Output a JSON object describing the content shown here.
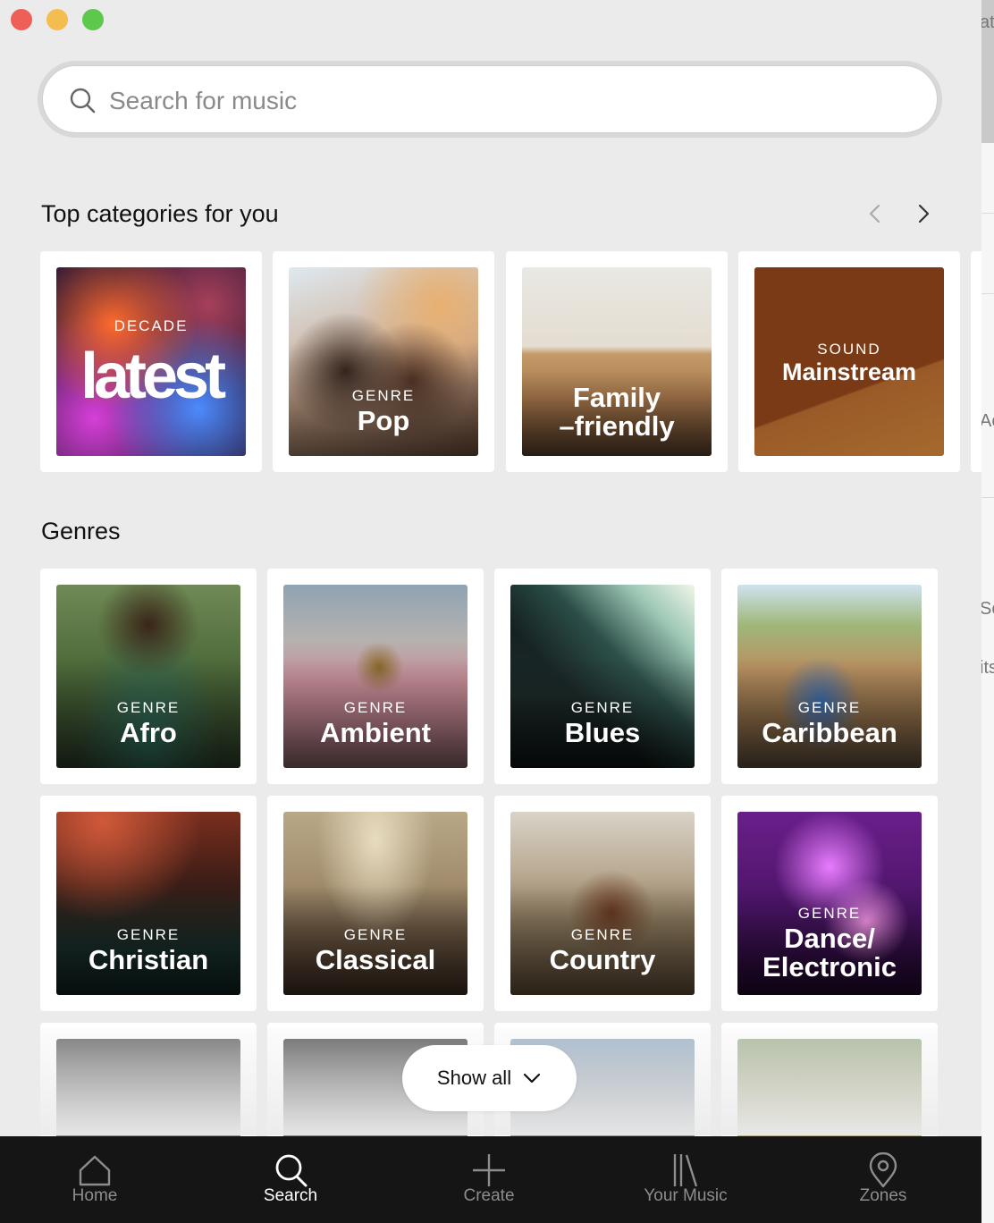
{
  "search": {
    "placeholder": "Search for music"
  },
  "sections": {
    "top_title": "Top categories for you",
    "genres_title": "Genres"
  },
  "top_categories": [
    {
      "kind": "DECADE",
      "name": "latest"
    },
    {
      "kind": "GENRE",
      "name": "Pop"
    },
    {
      "kind": "",
      "name": "Family\n–friendly"
    },
    {
      "kind": "SOUND",
      "name": "Mainstream"
    }
  ],
  "genres": [
    {
      "kind": "GENRE",
      "name": "Afro"
    },
    {
      "kind": "GENRE",
      "name": "Ambient"
    },
    {
      "kind": "GENRE",
      "name": "Blues"
    },
    {
      "kind": "GENRE",
      "name": "Caribbean"
    },
    {
      "kind": "GENRE",
      "name": "Christian"
    },
    {
      "kind": "GENRE",
      "name": "Classical"
    },
    {
      "kind": "GENRE",
      "name": "Country"
    },
    {
      "kind": "GENRE",
      "name": "Dance/\nElectronic"
    }
  ],
  "show_all": {
    "label": "Show all"
  },
  "tabs": [
    {
      "label": "Home",
      "icon": "home-icon",
      "active": false
    },
    {
      "label": "Search",
      "icon": "search-icon",
      "active": true
    },
    {
      "label": "Create",
      "icon": "plus-icon",
      "active": false
    },
    {
      "label": "Your Music",
      "icon": "library-icon",
      "active": false
    },
    {
      "label": "Zones",
      "icon": "location-pin-icon",
      "active": false
    }
  ],
  "background_window": {
    "fragments": [
      "at",
      "Ac",
      "Sc",
      "its"
    ]
  },
  "colors": {
    "tabbar_bg": "#151515",
    "tab_active": "#ffffff",
    "tab_inactive": "#8d8d8d",
    "mainstream_bg": "#7a3a16"
  }
}
